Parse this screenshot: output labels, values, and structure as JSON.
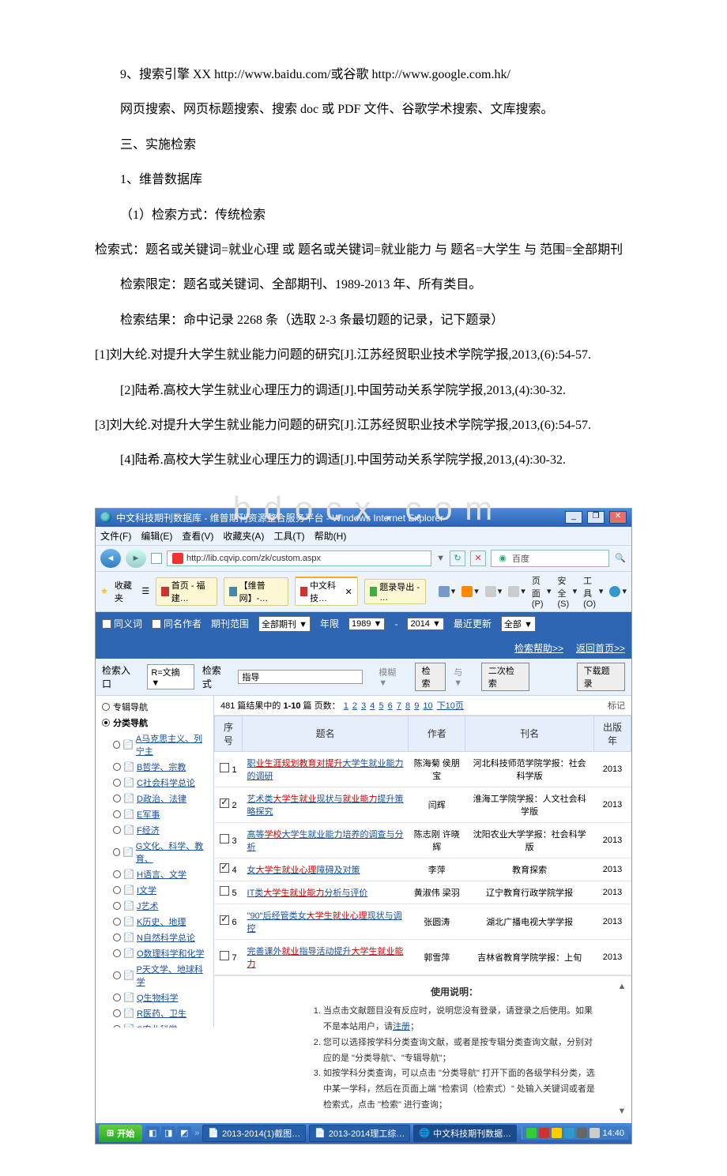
{
  "doc": {
    "p1": "9、搜索引擎 XX http://www.baidu.com/或谷歌 http://www.google.com.hk/",
    "p2": "网页搜索、网页标题搜索、搜索 doc 或 PDF 文件、谷歌学术搜索、文库搜索。",
    "p3": "三、实施检索",
    "p4": "1、维普数据库",
    "p5": "（1）检索方式：传统检索",
    "p6": "检索式：题名或关键词=就业心理 或 题名或关键词=就业能力 与 题名=大学生 与 范围=全部期刊",
    "p7": "检索限定：题名或关键词、全部期刊、1989-2013 年、所有类目。",
    "p8": "检索结果：命中记录 2268 条（选取 2-3 条最切题的记录，记下题录）",
    "p9": "[1]刘大纶.对提升大学生就业能力问题的研究[J].江苏经贸职业技术学院学报,2013,(6):54-57.",
    "p10": "[2]陆希.高校大学生就业心理压力的调适[J].中国劳动关系学院学报,2013,(4):30-32.",
    "p11": "[3]刘大纶.对提升大学生就业能力问题的研究[J].江苏经贸职业技术学院学报,2013,(6):54-57.",
    "p12": "[4]陆希.高校大学生就业心理压力的调适[J].中国劳动关系学院学报,2013,(4):30-32."
  },
  "watermark": "b d o c x . c o m",
  "ie": {
    "title": "中文科技期刊数据库 - 维普期刊资源整合服务平台 - Windows Internet Explorer",
    "menu": {
      "file": "文件(F)",
      "edit": "编辑(E)",
      "view": "查看(V)",
      "fav": "收藏夹(A)",
      "tools": "工具(T)",
      "help": "帮助(H)"
    },
    "address": "http://lib.cqvip.com/zk/custom.aspx",
    "search_placeholder": "百度",
    "favorites_label": "收藏夹",
    "tabs": {
      "t1": "首页 - 福建…",
      "t2": "【维普网】-…",
      "t3": "中文科技…",
      "t4": "题录导出 - …"
    },
    "toolbar": {
      "home": "",
      "feed": "",
      "mail": "",
      "print": "",
      "page": "页面(P)",
      "safety": "安全(S)",
      "tools2": "工具(O)",
      "help2": ""
    }
  },
  "form": {
    "synonym": "同义词",
    "coauthor": "同名作者",
    "journal_range_label": "期刊范围",
    "journal_range_value": "全部期刊",
    "year_label": "年限",
    "year_from": "1989",
    "year_to": "2014",
    "recent_label": "最近更新",
    "recent_value": "全部",
    "help_link": "检索帮助>>",
    "home_link": "返回首页>>",
    "entry_label": "检索入口",
    "entry_value": "R=文摘",
    "expr_label": "检索式",
    "expr_value": "指导",
    "btn_fuzzy": "模糊",
    "btn_search": "检索",
    "btn_and": "与",
    "btn_secondary": "二次检索",
    "btn_download": "下载题录"
  },
  "sidebar": {
    "nav_special": "专辑导航",
    "nav_category": "分类导航",
    "cats": [
      "A马克思主义、列宁主",
      "B哲学、宗教",
      "C社会科学总论",
      "D政治、法律",
      "E军事",
      "F经济",
      "G文化、科学、教育、",
      "H语言、文学",
      "I文学",
      "J艺术",
      "K历史、地理",
      "N自然科学总论",
      "O数理科学和化学",
      "P天文学、地球科学",
      "Q生物科学",
      "R医药、卫生",
      "S农业科学"
    ]
  },
  "results": {
    "count_prefix": "481 篇结果中的 ",
    "count_range": "1-10",
    "count_suffix": " 篇  页数：",
    "pages": [
      "1",
      "2",
      "3",
      "4",
      "5",
      "6",
      "7",
      "8",
      "9",
      "10",
      "下10页"
    ],
    "mark_label": "标记",
    "th_seq": "序号",
    "th_title": "题名",
    "th_author": "作者",
    "th_journal": "刊名",
    "th_year": "出版年",
    "rows": [
      {
        "n": "1",
        "chk": false,
        "title_pre": "职",
        "title_kw": "业生涯规划教育对提升",
        "title_mid": "大学生就业能力",
        "title_post": "的调研",
        "author": "陈海菊 侯朋宝",
        "journal": "河北科技师范学院学报：社会科学版",
        "year": "2013"
      },
      {
        "n": "2",
        "chk": true,
        "title_pre": "艺术类",
        "title_kw": "大学生就业",
        "title_mid": "现状与",
        "title_kw2": "就业能力",
        "title_post": "提升策略探究",
        "author": "闫辉",
        "journal": "淮海工学院学报：人文社会科学版",
        "year": "2013"
      },
      {
        "n": "3",
        "chk": false,
        "title_pre": "高等",
        "title_kw": "学校",
        "title_mid": "大学生就业能力",
        "title_post": "培养的调查与分析",
        "author": "陈志刚 许晓辉",
        "journal": "沈阳农业大学学报：社会科学版",
        "year": "2013"
      },
      {
        "n": "4",
        "chk": true,
        "title_pre": "女",
        "title_kw": "大学生就业心理",
        "title_mid": "障碍及对策",
        "title_post": "",
        "author": "李萍",
        "journal": "教育探索",
        "year": "2013"
      },
      {
        "n": "5",
        "chk": false,
        "title_pre": "IT类",
        "title_kw": "大学生就业能力",
        "title_mid": "分析与评价",
        "title_post": "",
        "author": "黄淑伟 梁羽",
        "journal": "辽宁教育行政学院学报",
        "year": "2013"
      },
      {
        "n": "6",
        "chk": true,
        "title_pre": "\"90\"后经管类女",
        "title_kw": "大学生就业心理",
        "title_mid": "现状与调控",
        "title_post": "",
        "author": "张圆涛",
        "journal": "湖北广播电视大学学报",
        "year": "2013"
      },
      {
        "n": "7",
        "chk": false,
        "title_pre": "完善课外",
        "title_kw": "就业",
        "title_mid": "指导活动提升",
        "title_kw2": "大学生就业能力",
        "title_post": "",
        "author": "郭雪萍",
        "journal": "吉林省教育学院学报：上旬",
        "year": "2013"
      }
    ]
  },
  "usage": {
    "title": "使用说明：",
    "li1_a": "当点击文献题目没有反应时，说明您没有登录，请登录之后使用。如果不是本站用户，",
    "li1_b": "请",
    "li1_link": "注册",
    "li1_c": "；",
    "li2": "您可以选择按学科分类查询文献，或者是按专辑分类查询文献，分别对应的是 \"分类导航\"、\"专辑导航\"；",
    "li3": "如按学科分类查询，可以点击 \"分类导航\" 打开下面的各级学科分类，选中某一学科，然后在页面上端 \"检索词（检索式）\" 处输入关键词或者是检索式，点击 \"检索\" 进行查询；"
  },
  "taskbar": {
    "start": "开始",
    "t1": "2013-2014(1)截图…",
    "t2": "2013-2014理工综…",
    "t3": "中文科技期刊数据…",
    "time": "14:40"
  }
}
